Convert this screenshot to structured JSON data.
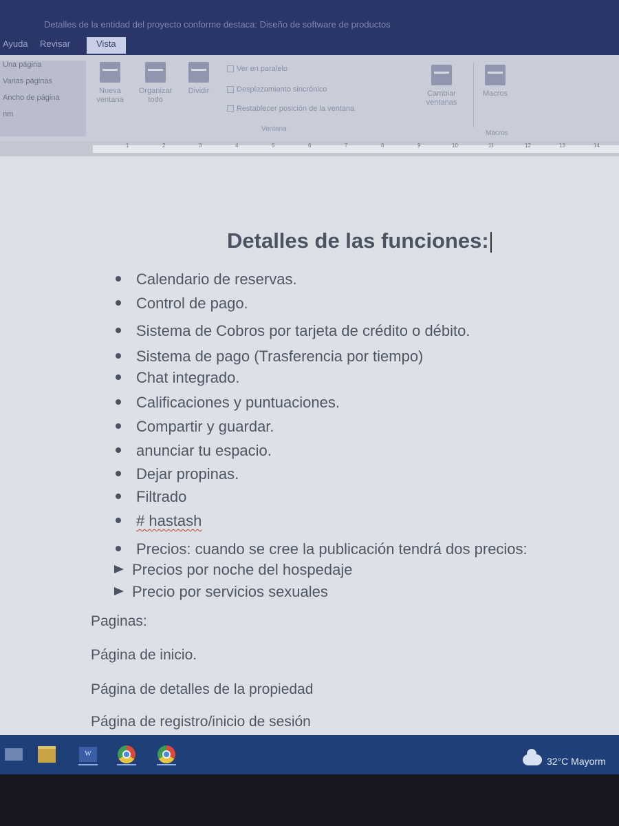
{
  "title_bar": {
    "document_title": "Detalles de la entidad del proyecto conforme destaca: Diseño de software de productos"
  },
  "tabs": [
    {
      "label": "Ayuda"
    },
    {
      "label": "Revisar"
    },
    {
      "label": "Vista"
    }
  ],
  "ribbon": {
    "zoom_items": [
      "Una página",
      "Varias páginas",
      "Ancho de página",
      "nm"
    ],
    "buttons": {
      "nueva_ventana": "Nueva ventana",
      "organizar_todo": "Organizar todo",
      "dividir": "Dividir",
      "cambiar_ventanas": "Cambiar ventanas",
      "macros": "Macros"
    },
    "checkboxes": [
      "Ver en paralelo",
      "Desplazamiento sincrónico",
      "Restablecer posición de la ventana"
    ],
    "groups": {
      "ventana": "Ventana",
      "macros": "Macros"
    }
  },
  "ruler": {
    "ticks": [
      "1",
      "2",
      "3",
      "4",
      "5",
      "6",
      "7",
      "8",
      "9",
      "10",
      "11",
      "12",
      "13",
      "14"
    ]
  },
  "document": {
    "heading": "Detalles de las funciones:",
    "bullets": [
      "Calendario de reservas.",
      "Control de pago.",
      "Sistema de Cobros por tarjeta de crédito o débito.",
      "Sistema de pago (Trasferencia por tiempo)",
      "Chat integrado.",
      "Calificaciones y puntuaciones.",
      "Compartir y guardar.",
      "anunciar tu espacio.",
      "Dejar propinas.",
      "Filtrado",
      "# hastash",
      "Precios: cuando se cree la publicación tendrá dos precios:"
    ],
    "sub_bullets": [
      "Precios por noche del hospedaje",
      "Precio por servicios sexuales"
    ],
    "paragraphs": [
      "Paginas:",
      "Página de inicio.",
      "Página de detalles de la propiedad",
      "Página de registro/inicio de sesión"
    ]
  },
  "taskbar": {
    "apps": [
      "windows-icon",
      "file-explorer-icon",
      "word-icon",
      "chrome-icon",
      "chrome-icon"
    ],
    "word_label": "W",
    "weather": "32°C  Mayorm"
  }
}
